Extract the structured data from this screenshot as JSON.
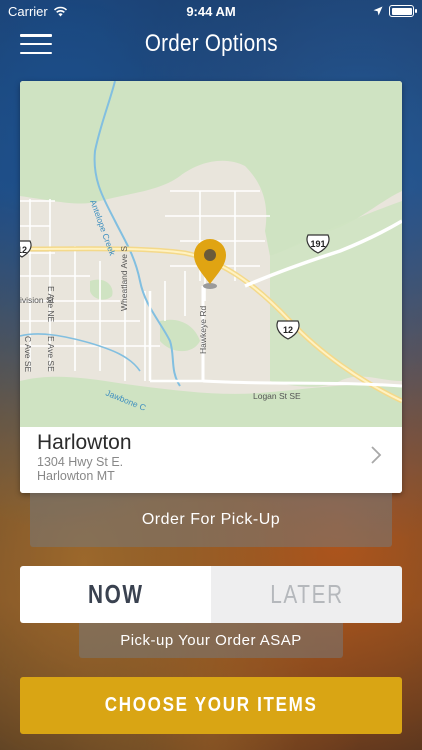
{
  "status_bar": {
    "carrier": "Carrier",
    "time": "9:44 AM",
    "icons": [
      "wifi-icon",
      "location-arrow-icon",
      "battery-icon"
    ]
  },
  "nav": {
    "title": "Order Options",
    "menu_icon": "hamburger-menu-icon"
  },
  "map": {
    "labels": {
      "antelope_creek": "Antelope Creek",
      "wheatland_ave": "Wheatland Ave S",
      "e_ave_ne": "E Ave NE",
      "division_st": "ivision St",
      "c_ave_se": "C Ave SE",
      "e_ave_se": "E Ave SE",
      "jawbone": "Jawbone C",
      "hawkeye_rd": "Hawkeye Rd",
      "logan_st": "Logan St SE",
      "hwy_191": "191",
      "hwy_12": "12",
      "hwy_12_left": "12"
    },
    "pin_color": "#e0a412"
  },
  "location": {
    "name": "Harlowton",
    "address_line1": "1304 Hwy St E.",
    "address_line2": "Harlowton MT"
  },
  "order_type": {
    "label": "Order For Pick-Up"
  },
  "timing": {
    "now_label": "NOW",
    "later_label": "LATER",
    "selected": "NOW",
    "asap_label": "Pick-up Your Order ASAP"
  },
  "cta": {
    "label": "CHOOSE YOUR ITEMS",
    "color": "#d9a514"
  }
}
